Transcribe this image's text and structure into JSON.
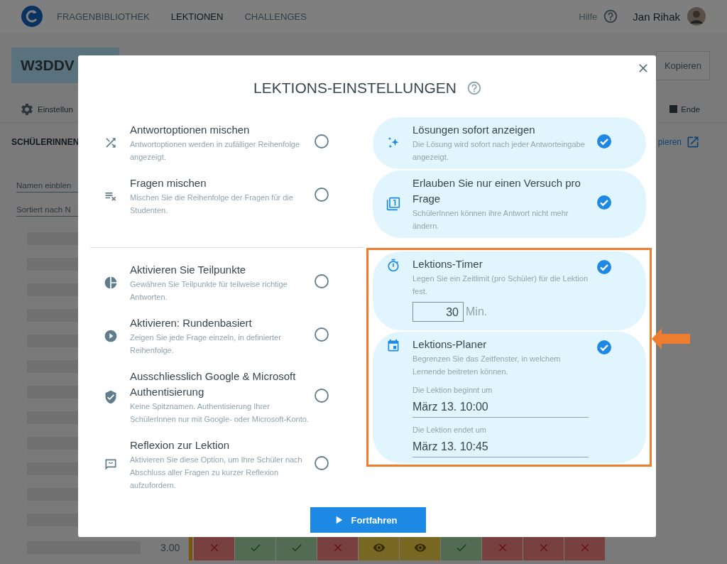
{
  "header": {
    "nav": [
      {
        "label": "FRAGENBIBLIOTHEK",
        "selected": false
      },
      {
        "label": "LEKTIONEN",
        "selected": true
      },
      {
        "label": "CHALLENGES",
        "selected": false
      }
    ],
    "help": "Hilfe",
    "user": "Jan Rihak"
  },
  "lesson": {
    "code": "W3DDV",
    "copy_button": "Kopieren",
    "settings_tab": "Einstellun",
    "end_button": "Ende",
    "students_label": "SCHÜLERINNEN",
    "copy_link": "pieren",
    "name_filter": "Namen einblen",
    "sort_filter": "Sortiert nach N",
    "score": "3.00",
    "answers": [
      {
        "kind": "wrong"
      },
      {
        "kind": "right"
      },
      {
        "kind": "right"
      },
      {
        "kind": "wrong"
      },
      {
        "kind": "seen"
      },
      {
        "kind": "seen"
      },
      {
        "kind": "right"
      },
      {
        "kind": "wrong"
      },
      {
        "kind": "wrong"
      },
      {
        "kind": "wrong"
      }
    ]
  },
  "dialog": {
    "title": "LEKTIONS-EINSTELLUNGEN",
    "sections": [
      {
        "left": {
          "highlighted": false,
          "items": [
            {
              "kind": "option",
              "title": "Antwortoptionen mischen",
              "description": "Antwortoptionen werden in zufälliger Reihenfolge angezeigt.",
              "checked": false
            },
            {
              "kind": "option",
              "title": "Fragen mischen",
              "description": "Mischen Sie die Reihenfolge der Fragen für die Studenten.",
              "checked": false
            }
          ]
        },
        "right": {
          "highlighted": false,
          "items": [
            {
              "kind": "option",
              "title": "Lösungen sofort anzeigen",
              "description": "Die Lösung wird sofort nach jeder Antworteingabe angezeigt.",
              "checked": true
            },
            {
              "kind": "option",
              "title": "Erlauben Sie nur einen Versuch pro Frage",
              "description": "SchülerInnen können ihre Antwort nicht mehr ändern.",
              "checked": true
            }
          ]
        }
      },
      {
        "left": {
          "highlighted": false,
          "items": [
            {
              "kind": "option",
              "title": "Aktivieren Sie Teilpunkte",
              "description": "Gewähren Sie Teilpunkte für teilweise richtige Antworten.",
              "checked": false
            },
            {
              "kind": "option",
              "title": "Aktivieren: Rundenbasiert",
              "description": "Zeigen Sie jede Frage einzeln, in definierter Reihenfolge.",
              "checked": false
            },
            {
              "kind": "option",
              "title": "Ausschliesslich Google & Microsoft Authentisierung",
              "description": "Keine Spitznamen. Authentisierung Ihrer SchülerInnen nur mit Google- oder Microsoft-Konto.",
              "checked": false
            },
            {
              "kind": "option",
              "title": "Reflexion zur Lektion",
              "description": "Aktivieren Sie diese Option, um Ihre Schüler nach Abschluss aller Fragen zu kurzer Reflexion aufzufordern.",
              "checked": false
            }
          ]
        },
        "right": {
          "highlighted": true,
          "items": [
            {
              "kind": "timer",
              "title": "Lektions-Timer",
              "description": "Legen Sie ein Zeitlimit (pro Schüler) für die Lektion fest.",
              "checked": true,
              "value": "30",
              "unit": "Min."
            },
            {
              "kind": "schedule",
              "title": "Lektions-Planer",
              "description": "Begrenzen Sie das Zeitfenster, in welchem Lernende beitreten können.",
              "checked": true,
              "fields": [
                {
                  "label": "Die Lektion beginnt um",
                  "value": "März 13. 10:00"
                },
                {
                  "label": "Die Lektion endet um",
                  "value": "März 13. 10:45"
                }
              ]
            }
          ]
        }
      }
    ],
    "continue_button": "Fortfahren"
  }
}
